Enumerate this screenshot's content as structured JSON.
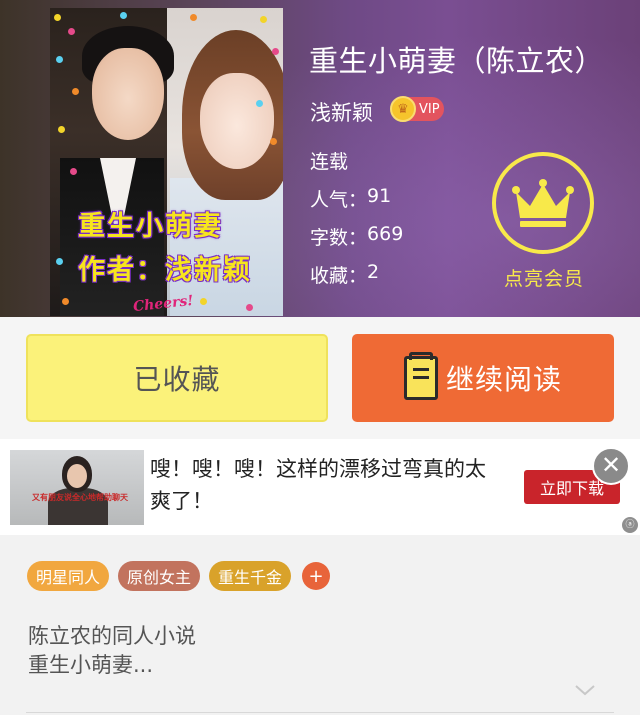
{
  "book": {
    "title": "重生小萌妻（陈立农）",
    "author": "浅新颖",
    "vip_label": "VIP",
    "status": "连载",
    "stats": [
      {
        "label": "人气：",
        "value": "91"
      },
      {
        "label": "字数：",
        "value": "669"
      },
      {
        "label": "收藏：",
        "value": "2"
      }
    ],
    "cover": {
      "title": "重生小萌妻",
      "author_line": "作者：浅新颖",
      "sticker": "Cheers!"
    }
  },
  "member": {
    "label": "点亮会员",
    "icon": "crown-icon"
  },
  "actions": {
    "collected_label": "已收藏",
    "read_label": "继续阅读"
  },
  "ad": {
    "text": "嗖！嗖！嗖！这样的漂移过弯真的太爽了！",
    "cta_label": "立即下载",
    "thumb_caption": "又有朋友说全心地帮助聊天",
    "close_icon": "close-icon"
  },
  "tags": [
    {
      "label": "明星同人",
      "color": "#f1a73f"
    },
    {
      "label": "原创女主",
      "color": "#c2735e"
    },
    {
      "label": "重生千金",
      "color": "#d9a22a"
    }
  ],
  "tag_add_label": "+",
  "summary": {
    "line1": "陈立农的同人小说",
    "line2": "重生小萌妻..."
  },
  "colors": {
    "accent_orange": "#ef6a35",
    "collected_yellow": "#fbf27a",
    "member_yellow": "#f8e94a",
    "ad_red": "#c9242b"
  }
}
